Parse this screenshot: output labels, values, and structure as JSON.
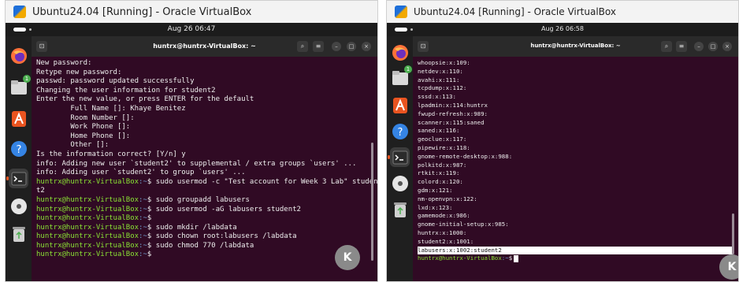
{
  "left": {
    "window_title": "Ubuntu24.04 [Running] - Oracle VirtualBox",
    "clock": "Aug 26 06:47",
    "terminal_title": "huntrx@huntrx-VirtualBox: ~",
    "dock_badge": "1",
    "k_badge": "K",
    "lines": [
      {
        "text": "New password:"
      },
      {
        "text": "Retype new password:"
      },
      {
        "text": "passwd: password updated successfully"
      },
      {
        "text": "Changing the user information for student2"
      },
      {
        "text": "Enter the new value, or press ENTER for the default"
      },
      {
        "text": "        Full Name []: Khaye Benitez"
      },
      {
        "text": "        Room Number []:"
      },
      {
        "text": "        Work Phone []:"
      },
      {
        "text": "        Home Phone []:"
      },
      {
        "text": "        Other []:"
      },
      {
        "text": "Is the information correct? [Y/n] y"
      },
      {
        "text": "info: Adding new user `student2' to supplemental / extra groups `users' ..."
      },
      {
        "text": "info: Adding user `student2' to group `users' ..."
      },
      {
        "user": "huntrx@huntrx-VirtualBox",
        "path": ":~",
        "cmd": "$ sudo usermod -c \"Test account for Week 3 Lab\" studen"
      },
      {
        "text": "t2"
      },
      {
        "user": "huntrx@huntrx-VirtualBox",
        "path": ":~",
        "cmd": "$ sudo groupadd labusers"
      },
      {
        "user": "huntrx@huntrx-VirtualBox",
        "path": ":~",
        "cmd": "$ sudo usermod -aG labusers student2"
      },
      {
        "user": "huntrx@huntrx-VirtualBox",
        "path": ":~",
        "cmd": "$"
      },
      {
        "user": "huntrx@huntrx-VirtualBox",
        "path": ":~",
        "cmd": "$ sudo mkdir /labdata"
      },
      {
        "user": "huntrx@huntrx-VirtualBox",
        "path": ":~",
        "cmd": "$ sudo chown root:labusers /labdata"
      },
      {
        "user": "huntrx@huntrx-VirtualBox",
        "path": ":~",
        "cmd": "$ sudo chmod 770 /labdata"
      },
      {
        "user": "huntrx@huntrx-VirtualBox",
        "path": ":~",
        "cmd": "$"
      }
    ]
  },
  "right": {
    "window_title": "Ubuntu24.04 [Running] - Oracle VirtualBox",
    "clock": "Aug 26 06:58",
    "terminal_title": "huntrx@huntrx-VirtualBox: ~",
    "dock_badge": "1",
    "k_badge": "K",
    "lines": [
      {
        "text": "whoopsie:x:109:"
      },
      {
        "text": "netdev:x:110:"
      },
      {
        "text": "avahi:x:111:"
      },
      {
        "text": "tcpdump:x:112:"
      },
      {
        "text": "sssd:x:113:"
      },
      {
        "text": "lpadmin:x:114:huntrx"
      },
      {
        "text": "fwupd-refresh:x:989:"
      },
      {
        "text": "scanner:x:115:saned"
      },
      {
        "text": "saned:x:116:"
      },
      {
        "text": "geoclue:x:117:"
      },
      {
        "text": "pipewire:x:118:"
      },
      {
        "text": "gnome-remote-desktop:x:988:"
      },
      {
        "text": "polkitd:x:987:"
      },
      {
        "text": "rtkit:x:119:"
      },
      {
        "text": "colord:x:120:"
      },
      {
        "text": "gdm:x:121:"
      },
      {
        "text": "nm-openvpn:x:122:"
      },
      {
        "text": "lxd:x:123:"
      },
      {
        "text": "gamemode:x:986:"
      },
      {
        "text": "gnome-initial-setup:x:985:"
      },
      {
        "text": "huntrx:x:1000:"
      },
      {
        "text": "student2:x:1001:"
      },
      {
        "text": "labusers:x:1002:student2",
        "highlight": true
      },
      {
        "user": "huntrx@huntrx-VirtualBox",
        "path": ":~",
        "cmd": "$",
        "cursor": true
      }
    ]
  }
}
